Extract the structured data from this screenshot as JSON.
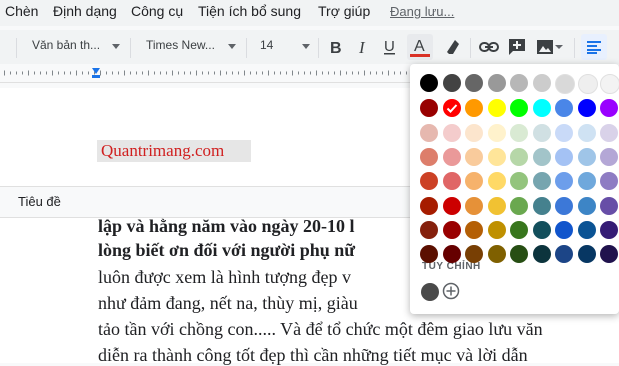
{
  "menubar": {
    "items": [
      "Chèn",
      "Định dạng",
      "Công cụ",
      "Tiện ích bổ sung",
      "Trợ giúp"
    ],
    "status": "Đang lưu..."
  },
  "toolbar": {
    "style": "Văn bản th...",
    "font": "Times New...",
    "size": "14",
    "text_color": "#d93025"
  },
  "document": {
    "watermark": "Quantrimang.com",
    "outline_label": "Tiêu đề",
    "lines": [
      "lập và hằng năm vào ngày 20-10 l",
      "lòng biết ơn đối với người phụ nữ",
      "luôn được xem là hình tượng đẹp v",
      "như đảm đang, nết na, thùy mị, giàu",
      "tảo tần với chồng con..... Và để tổ chức một đêm giao lưu văn",
      "diễn ra thành công tốt đẹp thì cần những tiết mục và lời dẫn"
    ]
  },
  "palette": {
    "selected": "#ff0000",
    "rows": [
      [
        "#000000",
        "#434343",
        "#666666",
        "#999999",
        "#b7b7b7",
        "#cccccc",
        "#d9d9d9",
        "#efefef",
        "#f3f3f3"
      ],
      [
        "#980000",
        "#ff0000",
        "#ff9900",
        "#ffff00",
        "#00ff00",
        "#00ffff",
        "#4a86e8",
        "#0000ff",
        "#9900ff"
      ],
      [
        "#e6b8af",
        "#f4cccc",
        "#fce5cd",
        "#fff2cc",
        "#d9ead3",
        "#d0e0e3",
        "#c9daf8",
        "#cfe2f3",
        "#d9d2e9"
      ],
      [
        "#dd7e6b",
        "#ea9999",
        "#f9cb9c",
        "#ffe599",
        "#b6d7a8",
        "#a2c4c9",
        "#a4c2f4",
        "#9fc5e8",
        "#b4a7d6"
      ],
      [
        "#cc4125",
        "#e06666",
        "#f6b26b",
        "#ffd966",
        "#93c47d",
        "#76a5af",
        "#6d9eeb",
        "#6fa8dc",
        "#8e7cc3"
      ],
      [
        "#a61c00",
        "#cc0000",
        "#e69138",
        "#f1c232",
        "#6aa84f",
        "#45818e",
        "#3c78d8",
        "#3d85c6",
        "#674ea7"
      ],
      [
        "#85200c",
        "#990000",
        "#b45f06",
        "#bf9000",
        "#38761d",
        "#134f5c",
        "#1155cc",
        "#0b5394",
        "#351c75"
      ],
      [
        "#5b0f00",
        "#660000",
        "#783f04",
        "#7f6000",
        "#274e13",
        "#0c343d",
        "#1c4587",
        "#073763",
        "#20124d"
      ]
    ],
    "custom_label": "TÙY CHỈNH",
    "custom_colors": [
      "#4a4a4a"
    ]
  }
}
